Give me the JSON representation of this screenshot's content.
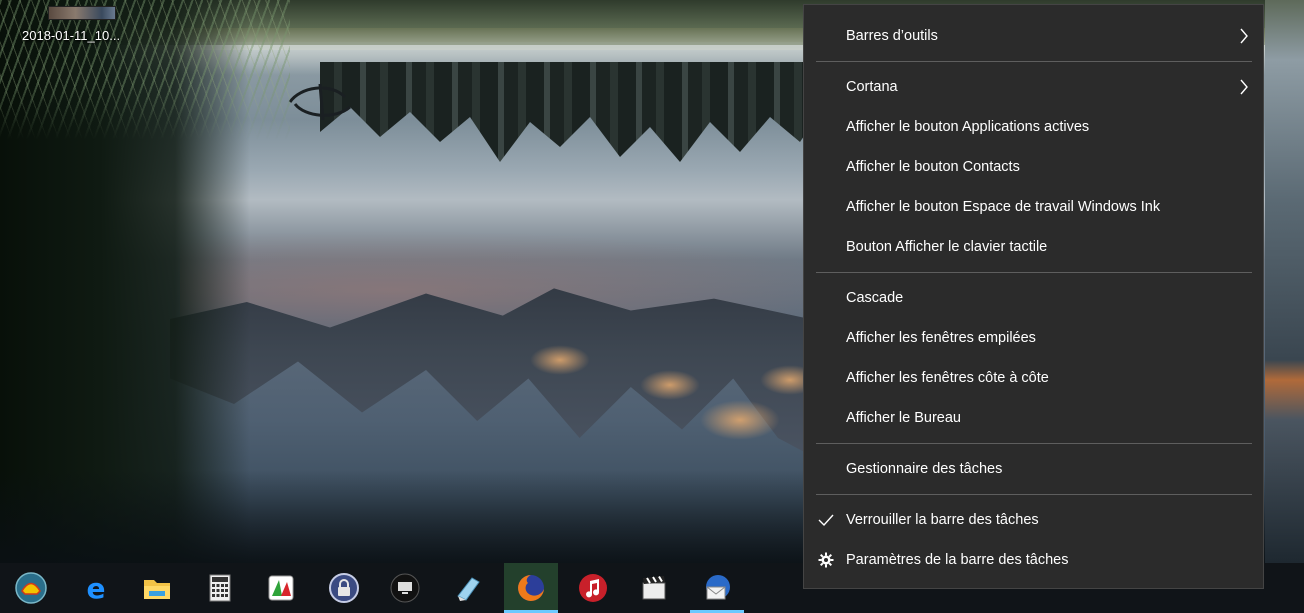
{
  "desktop": {
    "icon_label": "2018-01-11_10..."
  },
  "context_menu": {
    "groups": [
      [
        {
          "label": "Barres d’outils",
          "submenu": true
        }
      ],
      [
        {
          "label": "Cortana",
          "submenu": true
        },
        {
          "label": "Afficher le bouton Applications actives"
        },
        {
          "label": "Afficher le bouton Contacts"
        },
        {
          "label": "Afficher le bouton Espace de travail Windows Ink"
        },
        {
          "label": "Bouton Afficher le clavier tactile"
        }
      ],
      [
        {
          "label": "Cascade"
        },
        {
          "label": "Afficher les fenêtres empilées"
        },
        {
          "label": "Afficher les fenêtres côte à côte"
        },
        {
          "label": "Afficher le Bureau"
        }
      ],
      [
        {
          "label": "Gestionnaire des tâches"
        }
      ],
      [
        {
          "label": "Verrouiller la barre des tâches",
          "checked": true,
          "icon": "checkmark-icon"
        },
        {
          "label": "Paramètres de la barre des tâches",
          "icon": "gear-icon"
        }
      ]
    ]
  },
  "taskbar": {
    "items": [
      {
        "icon": "start-shell-icon"
      },
      {
        "icon": "edge-icon"
      },
      {
        "icon": "file-explorer-icon"
      },
      {
        "icon": "calculator-icon"
      },
      {
        "icon": "app-tricolor-icon"
      },
      {
        "icon": "lock-app-icon"
      },
      {
        "icon": "remote-desktop-icon"
      },
      {
        "icon": "notepad-pen-icon"
      },
      {
        "icon": "firefox-icon",
        "state": "active"
      },
      {
        "icon": "music-player-icon"
      },
      {
        "icon": "video-clapper-icon"
      },
      {
        "icon": "mail-client-icon",
        "state": "running"
      }
    ]
  },
  "colors": {
    "menu_bg": "#2b2b2b",
    "menu_text": "#ffffff",
    "taskbar_bg": "#101418",
    "accent": "#6cc9ff"
  }
}
